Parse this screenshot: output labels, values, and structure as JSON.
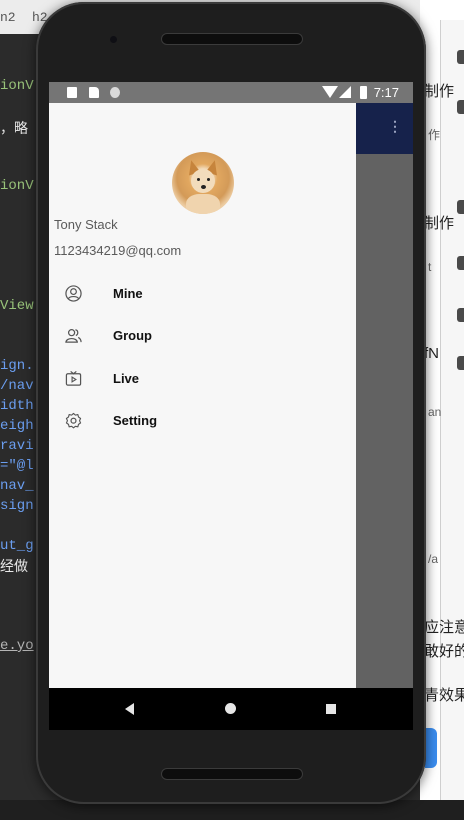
{
  "editor": {
    "tabs": [
      "n2",
      "h2"
    ],
    "code_lines": [
      {
        "text": "ionV",
        "style": "c-green"
      },
      {
        "text": "，略",
        "style": "c-white"
      },
      {
        "text": "ionV",
        "style": "c-green"
      },
      {
        "text": "View",
        "style": "c-green"
      },
      {
        "text": "ign.",
        "style": "c-blue"
      },
      {
        "text": "/nav",
        "style": "c-blue"
      },
      {
        "text": "idth",
        "style": "c-blue"
      },
      {
        "text": "eigh",
        "style": "c-blue"
      },
      {
        "text": "ravi",
        "style": "c-blue"
      },
      {
        "text": "=\"@l",
        "style": "c-blue"
      },
      {
        "text": "nav_",
        "style": "c-blue"
      },
      {
        "text": "sign",
        "style": "c-blue"
      },
      {
        "text": "ut_g",
        "style": "c-blue"
      },
      {
        "text": "经做",
        "style": "c-white"
      },
      {
        "text": "e.yo",
        "style": "c-under"
      }
    ]
  },
  "right_panel": {
    "texts": [
      "制作",
      "制作",
      "fN",
      "应注意",
      "敢好的",
      "青效果"
    ],
    "small_texts": [
      "作",
      "t",
      "an",
      "/a"
    ]
  },
  "status_bar": {
    "time": "7:17",
    "icons": [
      "a-icon",
      "sd-card-icon",
      "circle-icon",
      "wifi-icon",
      "signal-icon",
      "battery-icon"
    ]
  },
  "toolbar": {
    "background": "#16224b",
    "icons": [
      "filter-icon",
      "more-icon"
    ]
  },
  "drawer": {
    "user_name": "Tony Stack",
    "user_email": "1123434219@qq.com",
    "avatar": "shiba-dog-avatar",
    "menu": [
      {
        "label": "Mine",
        "icon": "user-icon"
      },
      {
        "label": "Group",
        "icon": "group-icon"
      },
      {
        "label": "Live",
        "icon": "tv-icon"
      },
      {
        "label": "Setting",
        "icon": "gear-icon"
      }
    ]
  },
  "nav_bar": {
    "buttons": [
      "back-button",
      "home-button",
      "recents-button"
    ]
  }
}
